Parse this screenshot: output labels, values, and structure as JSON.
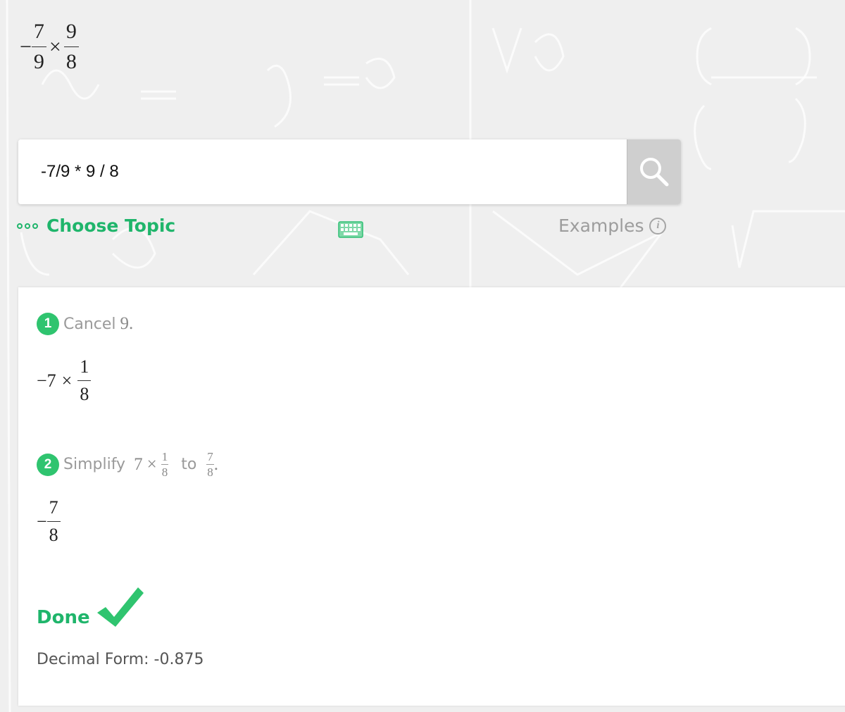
{
  "problem": {
    "sign": "−",
    "frac1_num": "7",
    "frac1_den": "9",
    "times": "×",
    "frac2_num": "9",
    "frac2_den": "8"
  },
  "search": {
    "value": "-7/9 * 9 / 8",
    "icon": "search-icon"
  },
  "toolbar": {
    "choose_topic_label": "Choose Topic",
    "keyboard_icon": "keyboard-icon",
    "examples_label": "Examples",
    "info_icon_glyph": "i"
  },
  "steps": [
    {
      "number": "1",
      "text_before": "Cancel",
      "math_value": "9",
      "period": ".",
      "result": {
        "sign": "−",
        "whole": "7",
        "times": "×",
        "num": "1",
        "den": "8"
      }
    },
    {
      "number": "2",
      "text_before": "Simplify",
      "expr_whole": "7",
      "expr_times": "×",
      "expr_num": "1",
      "expr_den": "8",
      "text_to": "to",
      "target_num": "7",
      "target_den": "8",
      "period": ".",
      "result": {
        "sign": "−",
        "num": "7",
        "den": "8"
      }
    }
  ],
  "done": {
    "label": "Done",
    "decimal_form": "Decimal Form: -0.875"
  },
  "colors": {
    "accent": "#1fb56b",
    "badge": "#2fc46f",
    "background": "#efefef"
  }
}
